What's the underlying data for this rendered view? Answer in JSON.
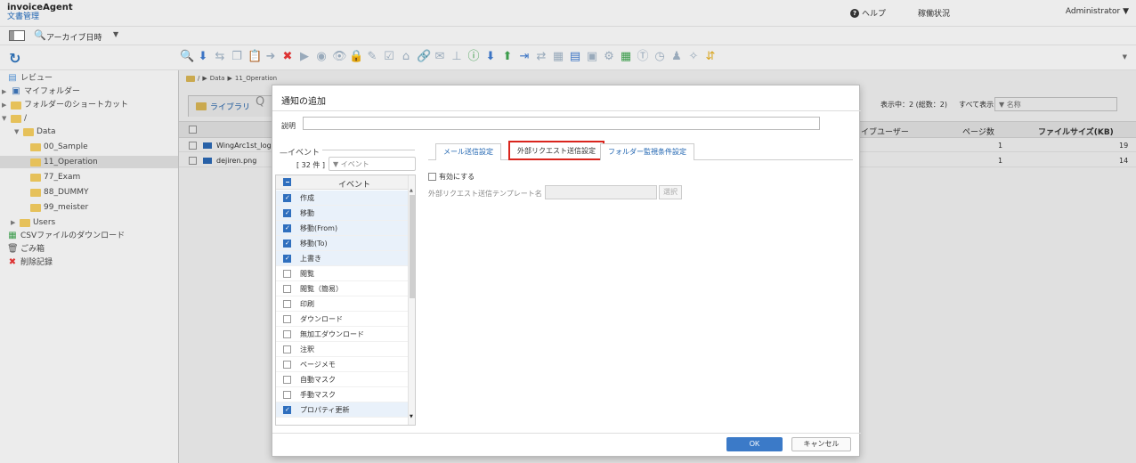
{
  "app": {
    "name": "invoiceAgent",
    "subtitle": "文書管理"
  },
  "header": {
    "help": "ヘルプ",
    "status": "稼働状況",
    "user": "Administrator ▼"
  },
  "archive": {
    "label": "アーカイブ日時",
    "caret": "▼"
  },
  "toolbar": {
    "icons": [
      "search-icon",
      "import-icon",
      "share-icon",
      "copy-icon",
      "paste-icon",
      "move-icon",
      "delete-icon",
      "play-icon",
      "stamp-icon",
      "view-icon",
      "lock-icon",
      "edit-icon",
      "check-icon",
      "tag-icon",
      "link-icon",
      "mail-icon",
      "split-icon",
      "info-icon",
      "download-icon",
      "upload-icon",
      "export-icon",
      "convert-icon",
      "compare-icon",
      "barcode-icon",
      "ocr-icon",
      "settings-icon",
      "calendar-icon",
      "text-icon",
      "history-icon",
      "user-icon",
      "notify-icon",
      "transfer-icon"
    ]
  },
  "tree": {
    "items": [
      {
        "label": "レビュー",
        "icon": "review-icon"
      },
      {
        "label": "マイフォルダー",
        "icon": "my-folder-icon"
      },
      {
        "label": "フォルダーのショートカット",
        "icon": "shortcut-icon"
      },
      {
        "label": "/",
        "icon": "folder-icon"
      },
      {
        "label": "Data",
        "icon": "folder-icon"
      },
      {
        "label": "00_Sample",
        "icon": "folder-icon"
      },
      {
        "label": "11_Operation",
        "icon": "folder-icon"
      },
      {
        "label": "77_Exam",
        "icon": "folder-icon"
      },
      {
        "label": "88_DUMMY",
        "icon": "folder-icon"
      },
      {
        "label": "99_meister",
        "icon": "folder-icon"
      },
      {
        "label": "Users",
        "icon": "folder-icon"
      },
      {
        "label": "CSVファイルのダウンロード",
        "icon": "csv-icon"
      },
      {
        "label": "ごみ箱",
        "icon": "trash-icon"
      },
      {
        "label": "削除記録",
        "icon": "delete-log-icon"
      }
    ]
  },
  "main": {
    "breadcrumb": [
      "/",
      "Data",
      "11_Operation"
    ],
    "library_tab": "ライブラリ",
    "counter": "表示中：2 (総数：2)",
    "filter": "すべて表示",
    "name_filter_placeholder": "名称",
    "columns": [
      "イブユーザー",
      "ページ数",
      "ファイルサイズ(KB)"
    ],
    "rows": [
      {
        "name": "WingArc1st_log",
        "pages": "1",
        "size": "19"
      },
      {
        "name": "dejiren.png",
        "pages": "1",
        "size": "14"
      }
    ]
  },
  "dialog": {
    "title": "通知の追加",
    "description_label": "説明",
    "description_value": "",
    "events_group": "イベント",
    "events_count": "[ 32 件 ]",
    "events_filter_placeholder": "イベント",
    "events_header": "イベント",
    "events": [
      {
        "label": "作成",
        "checked": true
      },
      {
        "label": "移動",
        "checked": true
      },
      {
        "label": "移動(From)",
        "checked": true
      },
      {
        "label": "移動(To)",
        "checked": true
      },
      {
        "label": "上書き",
        "checked": true
      },
      {
        "label": "閲覧",
        "checked": false
      },
      {
        "label": "閲覧（簡易）",
        "checked": false
      },
      {
        "label": "印刷",
        "checked": false
      },
      {
        "label": "ダウンロード",
        "checked": false
      },
      {
        "label": "無加工ダウンロード",
        "checked": false
      },
      {
        "label": "注釈",
        "checked": false
      },
      {
        "label": "ページメモ",
        "checked": false
      },
      {
        "label": "自動マスク",
        "checked": false
      },
      {
        "label": "手動マスク",
        "checked": false
      },
      {
        "label": "プロパティ更新",
        "checked": true
      }
    ],
    "tabs": [
      "メール送信設定",
      "外部リクエスト送信設定",
      "フォルダー監視条件設定"
    ],
    "active_tab": 1,
    "enable_label": "有効にする",
    "template_label": "外部リクエスト送信テンプレート名",
    "select_button": "選択",
    "ok": "OK",
    "cancel": "キャンセル"
  }
}
